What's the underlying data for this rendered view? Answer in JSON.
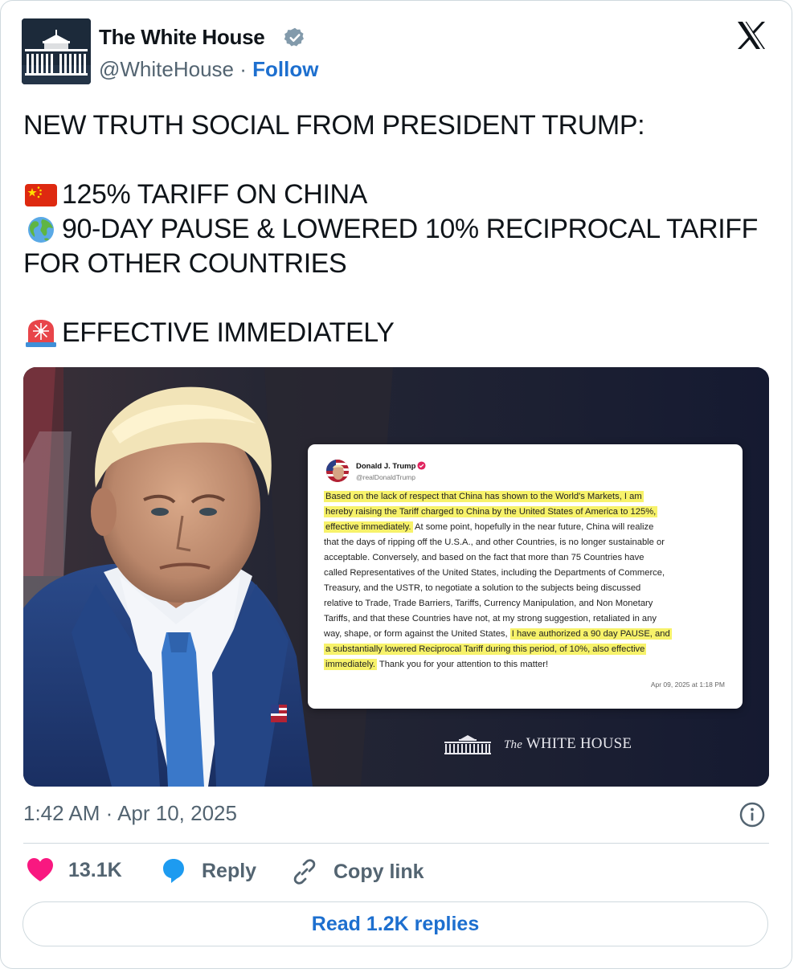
{
  "account": {
    "name": "The White House",
    "handle": "@WhiteHouse",
    "separator": "·",
    "follow_label": "Follow"
  },
  "tweet": {
    "line1": "NEW TRUTH SOCIAL FROM PRESIDENT TRUMP:",
    "line2": "125% TARIFF ON CHINA",
    "line3": "90-DAY PAUSE & LOWERED 10% RECIPROCAL TARIFF",
    "line4": "FOR OTHER COUNTRIES",
    "line5": "EFFECTIVE IMMEDIATELY",
    "emoji1": "china-flag-icon",
    "emoji2": "globe-icon",
    "emoji3": "rotating-light-icon"
  },
  "media": {
    "post_author": "Donald J. Trump",
    "post_handle": "@realDonaldTrump",
    "post_lines": [
      "Based on the lack of respect that China has shown to the World's Markets, I am",
      "hereby raising the Tariff charged to China by the United States of America to 125%,",
      "effective immediately.",
      " At some point, hopefully in the near future, China will realize",
      "that the days of ripping off the U.S.A., and other Countries, is no longer sustainable or",
      "acceptable. Conversely, and based on the fact that more than 75 Countries have",
      "called Representatives of the United States, including the Departments of Commerce,",
      "Treasury, and the USTR, to negotiate a solution to the subjects being discussed",
      "relative to Trade, Trade Barriers, Tariffs, Currency Manipulation, and Non Monetary",
      "Tariffs, and that these Countries have not, at my strong suggestion, retaliated in any",
      "way, shape, or form against the United States, ",
      "I have authorized a 90 day PAUSE, and",
      "a substantially lowered Reciprocal Tariff during this period, of 10%, also effective",
      "immediately.",
      " Thank you for your attention to this matter!"
    ],
    "post_date": "Apr 09, 2025 at 1:18 PM",
    "brand_the": "The",
    "brand_name": "WHITE HOUSE"
  },
  "meta": {
    "timestamp": "1:42 AM · Apr 10, 2025"
  },
  "actions": {
    "likes": "13.1K",
    "reply_label": "Reply",
    "copy_label": "Copy link",
    "read_replies": "Read 1.2K replies"
  },
  "colors": {
    "link_blue": "#1d6fcf",
    "like_pink": "#f91880",
    "reply_blue": "#1d9bf0",
    "muted": "#536471",
    "highlight": "#f7f26a"
  }
}
